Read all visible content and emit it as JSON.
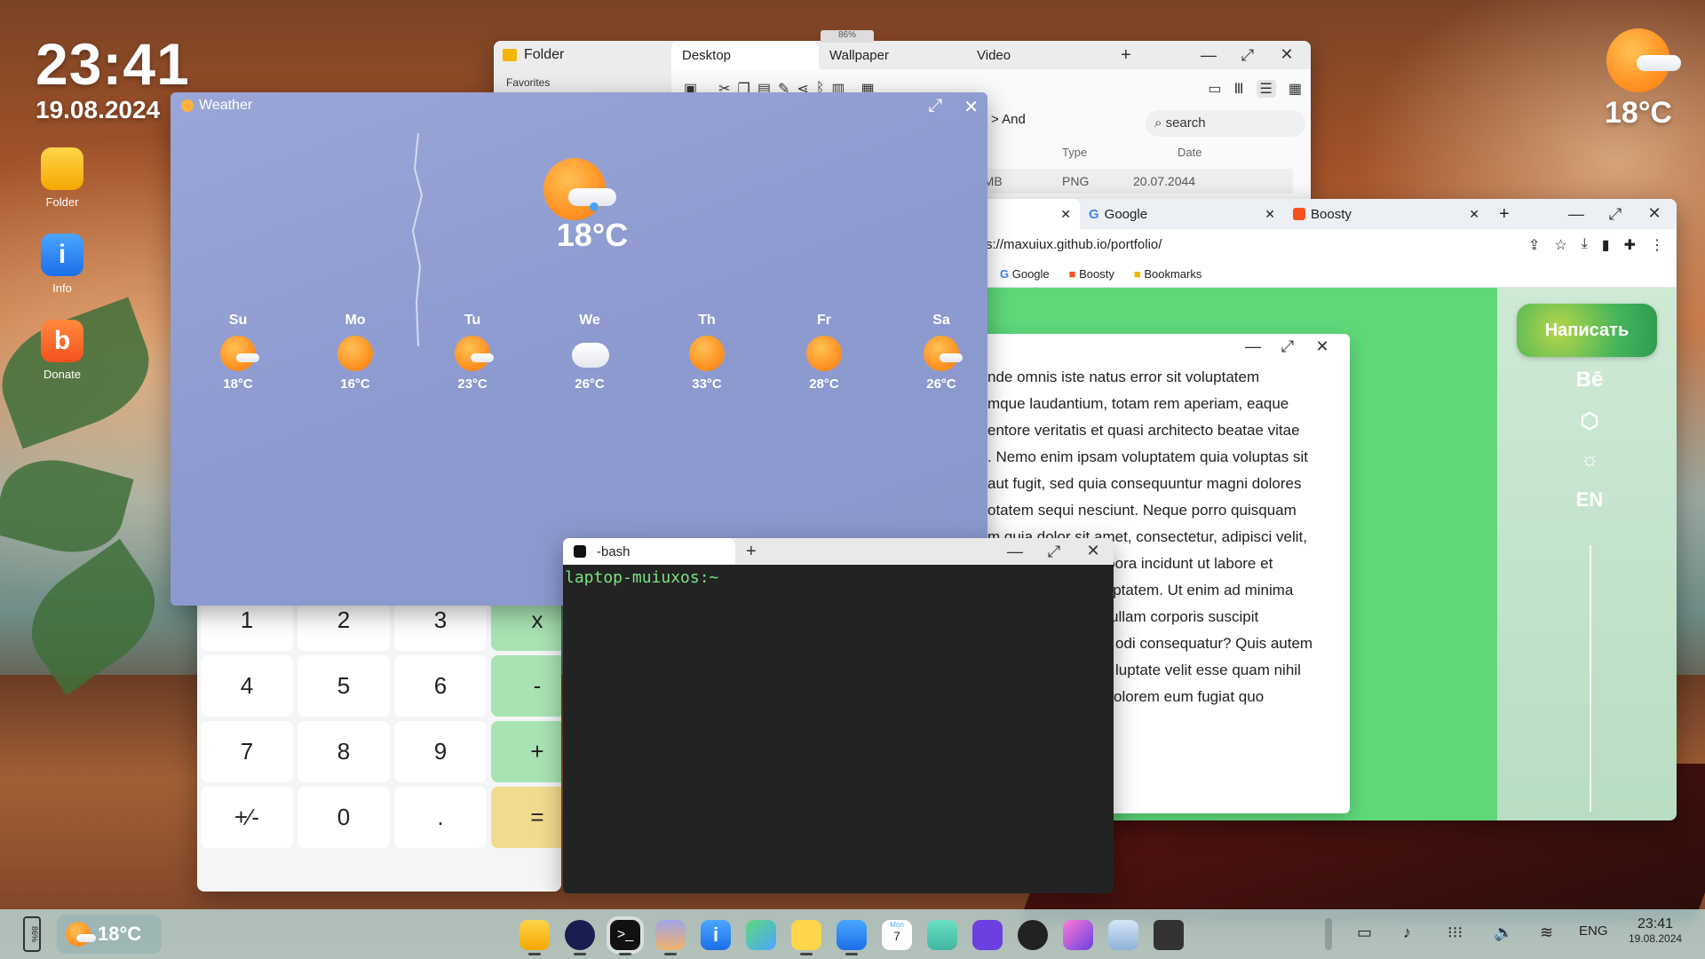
{
  "clock": {
    "time": "23:41",
    "date": "19.08.2024"
  },
  "desktop_icons": [
    {
      "label": "Folder"
    },
    {
      "label": "Info"
    },
    {
      "label": "Donate"
    }
  ],
  "top_weather": {
    "temp": "18°C"
  },
  "folder": {
    "title": "Folder",
    "tabs": [
      "Desktop",
      "Wallpaper",
      "Video"
    ],
    "sidebar_label": "Favorites",
    "path": "ch > And",
    "search_placeholder": "search",
    "columns": [
      "Type",
      "Date"
    ],
    "row": {
      "size": "0 MB",
      "type": "PNG",
      "date": "20.07.2044"
    },
    "battery_peek": "86%"
  },
  "browser": {
    "tabs": [
      "rtfolio",
      "Google",
      "Boosty"
    ],
    "url": "s://maxuiux.github.io/portfolio/",
    "bookmarks": [
      "Google",
      "Boosty",
      "Bookmarks"
    ],
    "write_button": "Написать",
    "side_items": [
      "Bē",
      "EN"
    ]
  },
  "text_window": {
    "lines": [
      "nde omnis iste natus error sit voluptatem",
      "mque laudantium, totam rem aperiam, eaque",
      "entore veritatis et quasi architecto beatae vitae",
      ". Nemo enim ipsam voluptatem quia voluptas sit",
      "aut fugit, sed quia consequuntur magni dolores",
      "otatem sequi nesciunt. Neque porro quisquam",
      "m quia dolor sit amet, consectetur, adipisci velit,",
      "mpora incidunt ut labore et",
      "luptatem. Ut enim ad minima",
      "ullam corporis suscipit",
      "odi consequatur? Quis autem",
      "luptate velit esse quam nihil",
      "olorem eum fugiat quo"
    ]
  },
  "weather": {
    "title": "Weather",
    "current_temp": "18°C",
    "days": [
      {
        "name": "Su",
        "temp": "18°C",
        "icon": "sun-cloud-icon"
      },
      {
        "name": "Mo",
        "temp": "16°C",
        "icon": "sun-icon"
      },
      {
        "name": "Tu",
        "temp": "23°C",
        "icon": "sun-cloud-icon"
      },
      {
        "name": "We",
        "temp": "26°C",
        "icon": "cloud-icon"
      },
      {
        "name": "Th",
        "temp": "33°C",
        "icon": "sun-icon"
      },
      {
        "name": "Fr",
        "temp": "28°C",
        "icon": "sun-icon"
      },
      {
        "name": "Sa",
        "temp": "26°C",
        "icon": "sun-cloud-icon"
      }
    ]
  },
  "calculator": {
    "keys": [
      "1",
      "2",
      "3",
      "x",
      "4",
      "5",
      "6",
      "-",
      "7",
      "8",
      "9",
      "+",
      "+∕-",
      "0",
      ".",
      "="
    ]
  },
  "terminal": {
    "tab": "-bash",
    "prompt": "laptop-muiuxos:~"
  },
  "taskbar": {
    "battery": "86%",
    "weather": "18°C",
    "lang": "ENG",
    "time": "23:41",
    "date": "19.08.2024",
    "calendar_day": "Mon",
    "calendar_num": "7"
  },
  "colors": {
    "accent_green": "#5fd87a",
    "weather_bg": "#8d9ad0",
    "terminal_bg": "#232323",
    "prompt": "#7ae27f"
  }
}
